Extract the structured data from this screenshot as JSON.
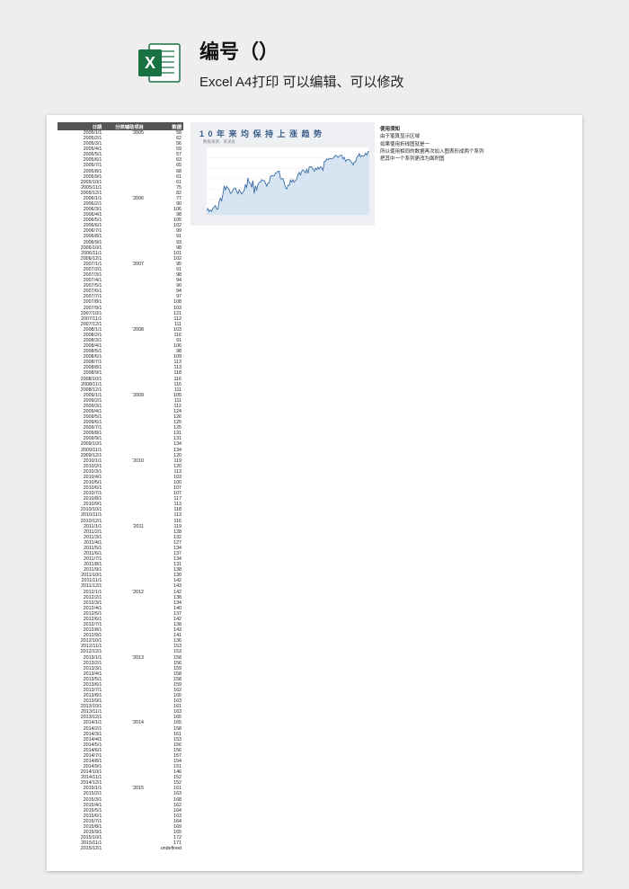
{
  "header": {
    "title": "编号（）",
    "subtitle": "Excel A4打印 可以编辑、可以修改"
  },
  "table": {
    "headers": [
      "日期",
      "分类辅助项目",
      "数据"
    ]
  },
  "chart_data": {
    "type": "line",
    "title": "1 0  年 来 均 保 持 上 涨 趋 势",
    "subtitle": "数据来源：某某处",
    "xlabel": "",
    "ylabel": "",
    "ylim": [
      50,
      180
    ],
    "x": [
      "2005/1/1",
      "2005/2/1",
      "2005/3/1",
      "2005/4/1",
      "2005/5/1",
      "2005/6/1",
      "2005/7/1",
      "2005/8/1",
      "2005/9/1",
      "2005/10/1",
      "2005/11/1",
      "2005/12/1",
      "2006/1/1",
      "2006/2/1",
      "2006/3/1",
      "2006/4/1",
      "2006/5/1",
      "2006/6/1",
      "2006/7/1",
      "2006/8/1",
      "2006/9/1",
      "2006/10/1",
      "2006/11/1",
      "2006/12/1",
      "2007/1/1",
      "2007/2/1",
      "2007/3/1",
      "2007/4/1",
      "2007/5/1",
      "2007/6/1",
      "2007/7/1",
      "2007/8/1",
      "2007/9/1",
      "2007/10/1",
      "2007/11/1",
      "2007/12/1",
      "2008/1/1",
      "2008/2/1",
      "2008/3/1",
      "2008/4/1",
      "2008/5/1",
      "2008/6/1",
      "2008/7/1",
      "2008/8/1",
      "2008/9/1",
      "2008/10/1",
      "2008/11/1",
      "2008/12/1",
      "2009/1/1",
      "2009/2/1",
      "2009/3/1",
      "2009/4/1",
      "2009/5/1",
      "2009/6/1",
      "2009/7/1",
      "2009/8/1",
      "2009/9/1",
      "2009/10/1",
      "2009/11/1",
      "2009/12/1",
      "2010/1/1",
      "2010/2/1",
      "2010/3/1",
      "2010/4/1",
      "2010/5/1",
      "2010/6/1",
      "2010/7/1",
      "2010/8/1",
      "2010/9/1",
      "2010/10/1",
      "2010/11/1",
      "2010/12/1",
      "2011/1/1",
      "2011/2/1",
      "2011/3/1",
      "2011/4/1",
      "2011/5/1",
      "2011/6/1",
      "2011/7/1",
      "2011/8/1",
      "2011/9/1",
      "2011/10/1",
      "2011/11/1",
      "2011/12/1",
      "2012/1/1",
      "2012/2/1",
      "2012/3/1",
      "2012/4/1",
      "2012/5/1",
      "2012/6/1",
      "2012/7/1",
      "2012/8/1",
      "2012/9/1",
      "2012/10/1",
      "2012/11/1",
      "2012/12/1",
      "2013/1/1",
      "2013/2/1",
      "2013/3/1",
      "2013/4/1",
      "2013/5/1",
      "2013/6/1",
      "2013/7/1",
      "2013/8/1",
      "2013/9/1",
      "2013/10/1",
      "2013/11/1",
      "2013/12/1",
      "2014/1/1",
      "2014/2/1",
      "2014/3/1",
      "2014/4/1",
      "2014/5/1",
      "2014/6/1",
      "2014/7/1",
      "2014/8/1",
      "2014/9/1",
      "2014/10/1",
      "2014/11/1",
      "2014/12/1",
      "2015/1/1",
      "2015/2/1",
      "2015/3/1",
      "2015/4/1",
      "2015/5/1",
      "2015/6/1",
      "2015/7/1",
      "2015/8/1",
      "2015/9/1",
      "2015/10/1",
      "2015/11/1",
      "2015/12/1"
    ],
    "values": [
      58,
      62,
      56,
      59,
      57,
      63,
      65,
      68,
      61,
      61,
      75,
      82,
      77,
      90,
      106,
      98,
      105,
      102,
      99,
      91,
      93,
      98,
      101,
      102,
      95,
      91,
      98,
      94,
      90,
      94,
      97,
      108,
      103,
      121,
      112,
      111,
      103,
      116,
      91,
      106,
      98,
      109,
      113,
      113,
      118,
      116,
      116,
      111,
      105,
      111,
      112,
      124,
      126,
      125,
      125,
      131,
      131,
      134,
      134,
      120,
      119,
      120,
      113,
      103,
      100,
      107,
      107,
      117,
      113,
      118,
      113,
      116,
      119,
      128,
      132,
      127,
      134,
      137,
      134,
      131,
      138,
      130,
      142,
      143,
      142,
      138,
      134,
      140,
      137,
      142,
      138,
      143,
      141,
      136,
      153,
      153,
      158,
      156,
      159,
      158,
      158,
      159,
      162,
      165,
      163,
      161,
      163,
      165,
      165,
      158,
      161,
      153,
      156,
      156,
      157,
      154,
      151,
      146,
      152,
      152,
      161,
      163,
      168,
      162,
      164,
      163,
      164,
      169,
      165,
      172,
      171
    ],
    "groups": {
      "2005": "'2005",
      "2006": "'2006",
      "2007": "'2007",
      "2008": "'2008",
      "2009": "'2009",
      "2010": "'2010",
      "2011": "'2011",
      "2012": "'2012",
      "2013": "'2013",
      "2014": "'2014",
      "2015": "'2015"
    }
  },
  "notes": {
    "title": "使用须知",
    "lines": [
      "由于笔算显示区域",
      "如果使用折线图就是一",
      "所以使用相同的数据再次加入图表形成两个系列",
      "把其中一个系列更改为面积图"
    ]
  }
}
